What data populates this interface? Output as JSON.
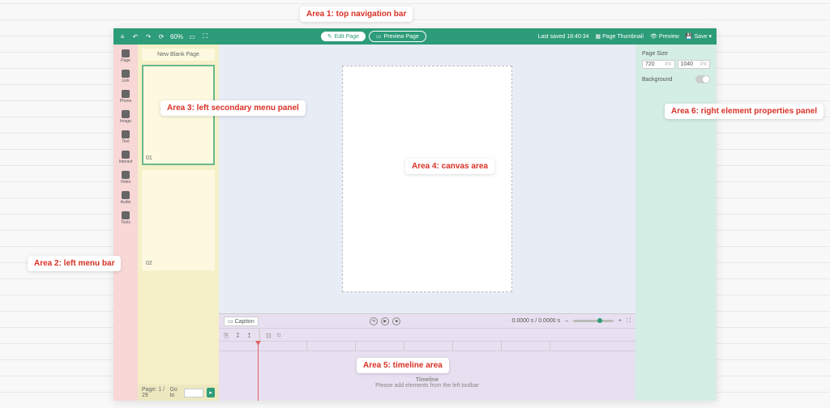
{
  "topbar": {
    "zoom": "60%",
    "edit_page": "Edit Page",
    "preview_page": "Preview Page",
    "last_saved": "Last saved 18:40:34",
    "page_thumbnail": "Page Thumbnail",
    "preview": "Preview",
    "save": "Save"
  },
  "leftbar": {
    "items": [
      {
        "label": "Page"
      },
      {
        "label": "Link"
      },
      {
        "label": "Phone"
      },
      {
        "label": "Image"
      },
      {
        "label": "Text"
      },
      {
        "label": "Interact"
      },
      {
        "label": "Video"
      },
      {
        "label": "Audio"
      },
      {
        "label": "Tools"
      }
    ]
  },
  "secpanel": {
    "title": "New Blank Page",
    "thumbs": [
      "01",
      "02"
    ],
    "page_label": "Page: 1 / 29",
    "goto_label": "Go to",
    "go_icon": "▸"
  },
  "timeline": {
    "caption_btn": "Caption",
    "time_text": "0.0000 s / 0.0000 s",
    "empty_title": "Timeline",
    "empty_sub": "Please add elements from the left toolbar"
  },
  "rightpanel": {
    "page_size_label": "Page Size",
    "width": "720",
    "height": "1040",
    "unit": "PX",
    "bg_label": "Background"
  },
  "annotations": {
    "a1": "Area 1: top navigation bar",
    "a2": "Area 2: left menu bar",
    "a3": "Area 3: left secondary menu panel",
    "a4": "Area 4: canvas area",
    "a5": "Area 5: timeline area",
    "a6": "Area 6: right element properties panel"
  }
}
